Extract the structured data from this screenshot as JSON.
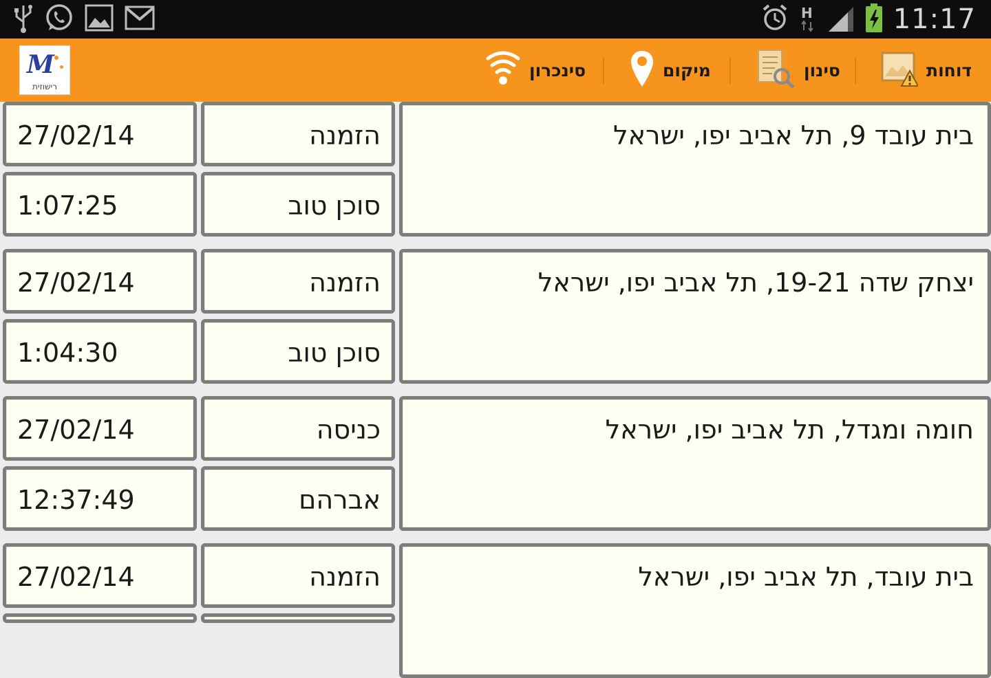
{
  "status_bar": {
    "clock": "11:17",
    "network_type": "H",
    "left_icons": [
      "usb-icon",
      "whatsapp-icon",
      "gallery-icon",
      "gmail-icon"
    ],
    "right_icons": [
      "alarm-icon",
      "network-h-icon",
      "signal-icon",
      "battery-charging-icon"
    ]
  },
  "action_bar": {
    "background": "#f7941e",
    "logo": {
      "letter": "M",
      "subtitle": "רישוזית"
    },
    "actions": [
      {
        "label": "דוחות",
        "icon": "report-icon"
      },
      {
        "label": "סינון",
        "icon": "filter-search-icon"
      },
      {
        "label": "מיקום",
        "icon": "location-pin-icon"
      },
      {
        "label": "סינכרון",
        "icon": "wifi-sync-icon"
      }
    ]
  },
  "records": [
    {
      "address": "בית עובד 9, תל אביב יפו, ישראל",
      "type": "הזמנה",
      "date": "27/02/14",
      "status": "סוכן טוב",
      "time": "1:07:25"
    },
    {
      "address": "יצחק שדה 19-21, תל אביב יפו, ישראל",
      "type": "הזמנה",
      "date": "27/02/14",
      "status": "סוכן טוב",
      "time": "1:04:30"
    },
    {
      "address": "חומה ומגדל, תל אביב יפו, ישראל",
      "type": "כניסה",
      "date": "27/02/14",
      "status": "אברהם",
      "time": "12:37:49"
    },
    {
      "address": "בית עובד, תל אביב יפו, ישראל",
      "type": "הזמנה",
      "date": "27/02/14",
      "status": "",
      "time": ""
    }
  ]
}
